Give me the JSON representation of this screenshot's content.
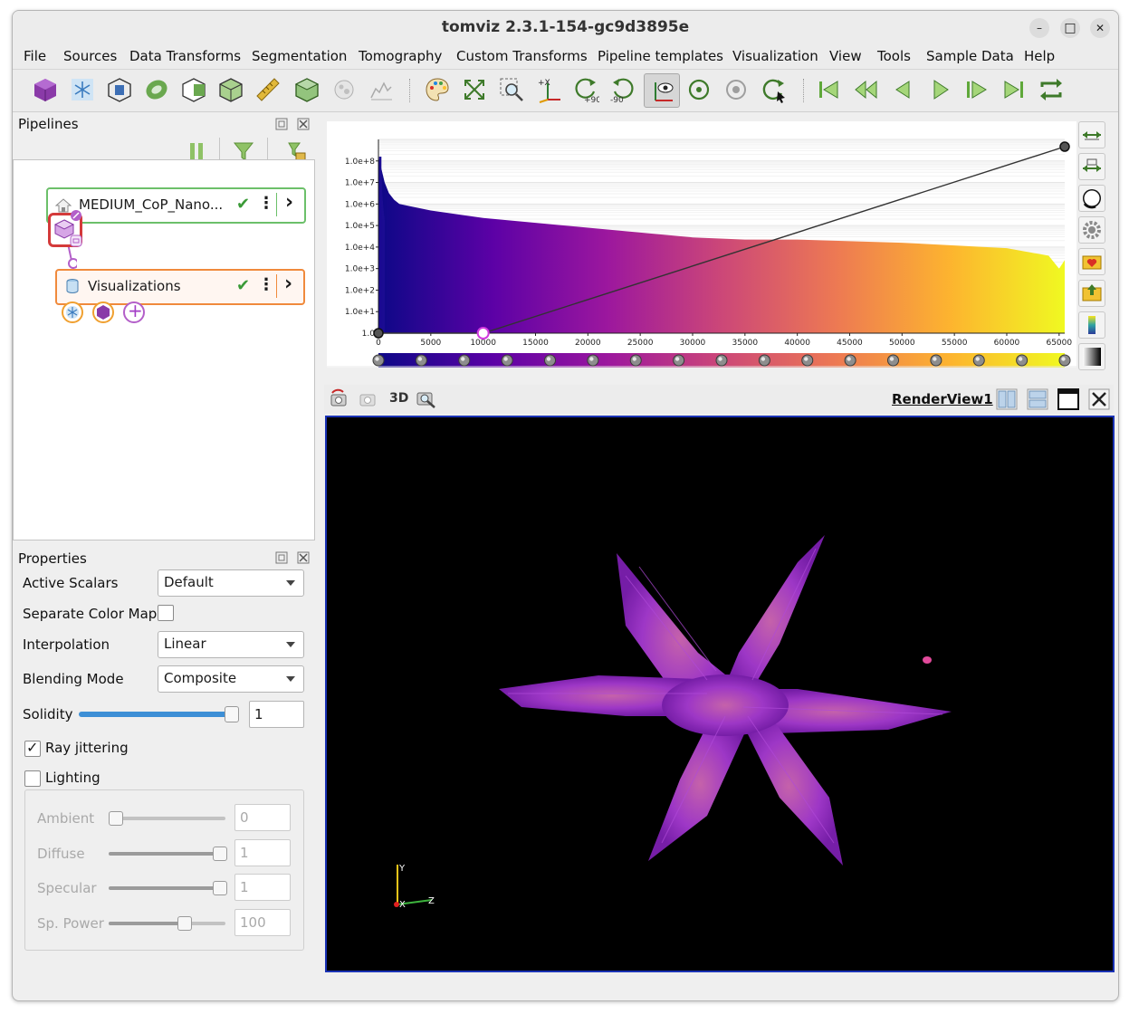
{
  "window": {
    "title": "tomviz 2.3.1-154-gc9d3895e",
    "min_label": "–",
    "max_label": "□",
    "close_label": "✕"
  },
  "menu": {
    "items": [
      "File",
      "Sources",
      "Data Transforms",
      "Segmentation",
      "Tomography",
      "Custom Transforms",
      "Pipeline templates",
      "Visualization",
      "View",
      "Tools",
      "Sample Data",
      "Help"
    ]
  },
  "toolbar": {
    "icons": [
      "cube-icon",
      "snowflake-icon",
      "box-outline-icon",
      "slice-disc-icon",
      "clip-box-icon",
      "open-box-icon",
      "ruler-icon",
      "contour-cube-icon",
      "particles-icon",
      "histogram-icon",
      "palette-icon",
      "reset-zoom-icon",
      "zoom-region-icon",
      "set-axis-icon",
      "rotate-plus90-icon",
      "rotate-minus90-icon",
      "interaction-mode-icon",
      "reset-rotation-icon",
      "center-icon",
      "rotate-icon",
      "first-frame-icon",
      "previous-frame-icon",
      "step-back-icon",
      "play-icon",
      "step-forward-icon",
      "last-frame-icon",
      "loop-icon"
    ],
    "rot_plus_label": "+90",
    "rot_minus_label": "-90",
    "set_axis_label": "+X"
  },
  "pipelines": {
    "header": "Pipelines",
    "data_node": {
      "name": "MEDIUM_CoP_Nano...",
      "status": "✔",
      "more": "⋮",
      "expand": "›"
    },
    "vis_node": {
      "name": "Visualizations",
      "status": "✔",
      "more": "⋮",
      "expand": "›"
    },
    "add_symbol": "+"
  },
  "properties": {
    "header": "Properties",
    "active_scalars": {
      "label": "Active Scalars",
      "value": "Default"
    },
    "separate_color_map": {
      "label": "Separate Color Map",
      "checked": false
    },
    "interpolation": {
      "label": "Interpolation",
      "value": "Linear"
    },
    "blending_mode": {
      "label": "Blending Mode",
      "value": "Composite"
    },
    "solidity": {
      "label": "Solidity",
      "value": "1",
      "slider_fraction": 1.0
    },
    "ray_jittering": {
      "label": "Ray jittering",
      "checked": true,
      "mark": "✓"
    },
    "lighting": {
      "label": "Lighting",
      "checked": false
    },
    "ambient": {
      "label": "Ambient",
      "value": "0",
      "slider_fraction": 0.0
    },
    "diffuse": {
      "label": "Diffuse",
      "value": "1",
      "slider_fraction": 1.0
    },
    "specular": {
      "label": "Specular",
      "value": "1",
      "slider_fraction": 1.0
    },
    "sp_power": {
      "label": "Sp. Power",
      "value": "100",
      "slider_fraction": 0.65
    }
  },
  "chart_data": {
    "type": "bar",
    "y_scale": "log",
    "y_tick_labels": [
      "1.0",
      "1.0e+1",
      "1.0e+2",
      "1.0e+3",
      "1.0e+4",
      "1.0e+5",
      "1.0e+6",
      "1.0e+7",
      "1.0e+8"
    ],
    "x_tick_labels": [
      "0",
      "5000",
      "10000",
      "15000",
      "20000",
      "25000",
      "30000",
      "35000",
      "40000",
      "45000",
      "50000",
      "55000",
      "60000",
      "65000"
    ],
    "xlim": [
      0,
      65535
    ],
    "ylim_log10": [
      0,
      9
    ],
    "histogram_profile": {
      "x": [
        0,
        200,
        600,
        1000,
        1500,
        2000,
        3000,
        5000,
        10000,
        20000,
        30000,
        35000,
        40000,
        50000,
        60000,
        64000,
        65000,
        65535
      ],
      "log10_count": [
        8.2,
        7.8,
        7.0,
        6.5,
        6.2,
        6.0,
        5.9,
        5.7,
        5.35,
        4.9,
        4.45,
        4.35,
        4.35,
        4.2,
        3.95,
        3.6,
        3.0,
        3.4
      ]
    },
    "opacity_points": [
      {
        "x": 0,
        "opacity": 0.0
      },
      {
        "x": 10000,
        "opacity": 0.0
      },
      {
        "x": 65535,
        "opacity": 1.0
      }
    ],
    "colormap": "plasma",
    "colormap_stops": [
      "#0d0887",
      "#5c01a6",
      "#9c179e",
      "#cc4778",
      "#ed7953",
      "#fdb42f",
      "#f0f921"
    ],
    "color_node_count": 17
  },
  "side_buttons": {
    "icons": [
      "range-expand-icon",
      "custom-range-icon",
      "preset-circle-icon",
      "settings-gear-icon",
      "save-preset-icon",
      "import-preset-icon",
      "colorbar-icon",
      "grayscale-icon"
    ]
  },
  "render_view": {
    "name": "RenderView1",
    "mode_3d": "3D",
    "icons": [
      "camera-undo-icon",
      "camera-redo-icon",
      "camera-capture-icon"
    ],
    "layout_icons": [
      "split-horizontal-icon",
      "split-vertical-icon",
      "maximize-icon",
      "close-view-icon"
    ],
    "axes": {
      "y": "Y",
      "x": "X",
      "z": "Z"
    },
    "object_color": "#a63ad1"
  }
}
